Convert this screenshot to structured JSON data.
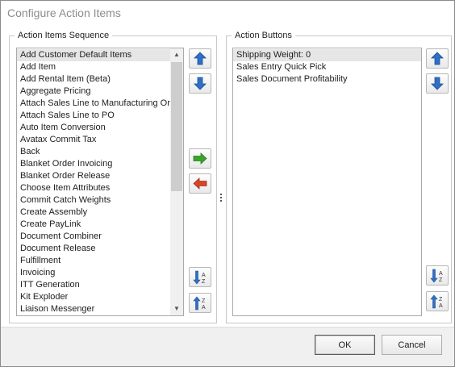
{
  "window": {
    "title": "Configure Action Items"
  },
  "sequence": {
    "legend": "Action Items Sequence",
    "items": [
      "Add Customer Default Items",
      "Add Item",
      "Add Rental Item (Beta)",
      "Aggregate Pricing",
      "Attach Sales Line to Manufacturing Or",
      "Attach Sales Line to PO",
      "Auto Item Conversion",
      "Avatax Commit Tax",
      "Back",
      "Blanket Order Invoicing",
      "Blanket Order Release",
      "Choose Item Attributes",
      "Commit Catch Weights",
      "Create Assembly",
      "Create PayLink",
      "Document Combiner",
      "Document Release",
      "Fulfillment",
      "Invoicing",
      "ITT Generation",
      "Kit Exploder",
      "Liaison Messenger"
    ],
    "selected_index": 0
  },
  "buttons_group": {
    "legend": "Action Buttons",
    "items": [
      "Shipping Weight: 0",
      "Sales Entry Quick Pick",
      "Sales Document Profitability"
    ],
    "selected_index": 0
  },
  "footer": {
    "ok_label": "OK",
    "cancel_label": "Cancel"
  },
  "colors": {
    "arrow_blue": "#2f6fc4",
    "arrow_green": "#3aa52a",
    "arrow_red": "#d6452a"
  }
}
